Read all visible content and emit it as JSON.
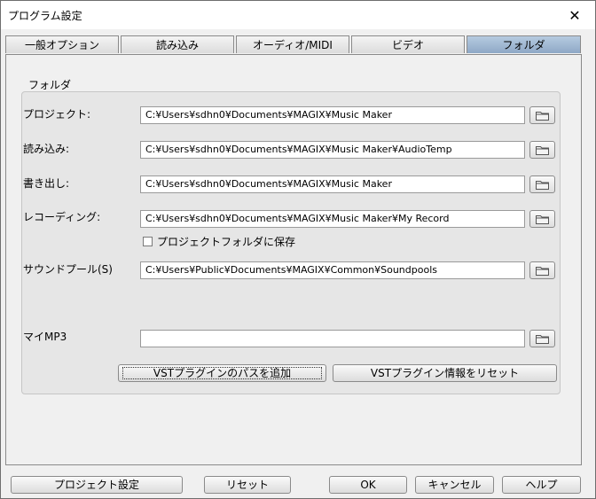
{
  "window": {
    "title": "プログラム設定",
    "close_symbol": "✕"
  },
  "tabs": [
    {
      "label": "一般オプション",
      "active": false
    },
    {
      "label": "読み込み",
      "active": false
    },
    {
      "label": "オーディオ/MIDI",
      "active": false
    },
    {
      "label": "ビデオ",
      "active": false
    },
    {
      "label": "フォルダ",
      "active": true
    }
  ],
  "group": {
    "label": "フォルダ"
  },
  "folders": [
    {
      "label": "プロジェクト:",
      "path": "C:¥Users¥sdhn0¥Documents¥MAGIX¥Music Maker",
      "icon": "folder-icon"
    },
    {
      "label": "読み込み:",
      "path": "C:¥Users¥sdhn0¥Documents¥MAGIX¥Music Maker¥AudioTemp",
      "icon": "folder-icon"
    },
    {
      "label": "書き出し:",
      "path": "C:¥Users¥sdhn0¥Documents¥MAGIX¥Music Maker",
      "icon": "folder-icon"
    },
    {
      "label": "レコーディング:",
      "path": "C:¥Users¥sdhn0¥Documents¥MAGIX¥Music Maker¥My Record",
      "icon": "folder-icon"
    },
    {
      "label": "サウンドプール(S)",
      "path": "C:¥Users¥Public¥Documents¥MAGIX¥Common¥Soundpools",
      "icon": "folder-icon"
    },
    {
      "label": "マイMP3",
      "path": "",
      "icon": "folder-icon"
    }
  ],
  "save_in_project": {
    "label": "プロジェクトフォルダに保存",
    "checked": false
  },
  "vst": {
    "add_path_label": "VSTプラグインのパスを追加",
    "reset_label": "VSTプラグイン情報をリセット"
  },
  "footer": {
    "project_settings_label": "プロジェクト設定",
    "reset_label": "リセット",
    "ok_label": "OK",
    "cancel_label": "キャンセル",
    "help_label": "ヘルプ"
  },
  "colors": {
    "active_tab": "#8ea8c6",
    "group_bg": "#e6e6e6"
  }
}
